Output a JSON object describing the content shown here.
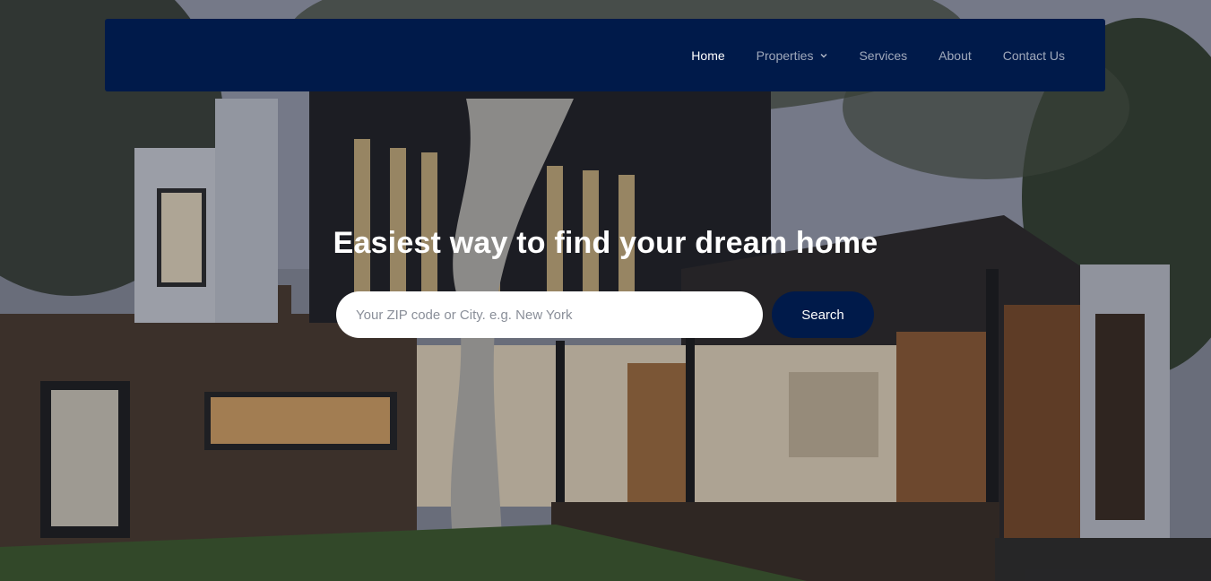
{
  "nav": {
    "items": [
      {
        "label": "Home",
        "active": true
      },
      {
        "label": "Properties",
        "dropdown": true
      },
      {
        "label": "Services"
      },
      {
        "label": "About"
      },
      {
        "label": "Contact Us"
      }
    ]
  },
  "hero": {
    "headline": "Easiest way to find your dream home",
    "search": {
      "placeholder": "Your ZIP code or City. e.g. New York",
      "button_label": "Search"
    }
  },
  "colors": {
    "navbar_bg": "#001a4a",
    "button_bg": "#001a4a",
    "text_light": "#ffffff"
  },
  "icons": {
    "dropdown": "chevron-down-icon"
  }
}
